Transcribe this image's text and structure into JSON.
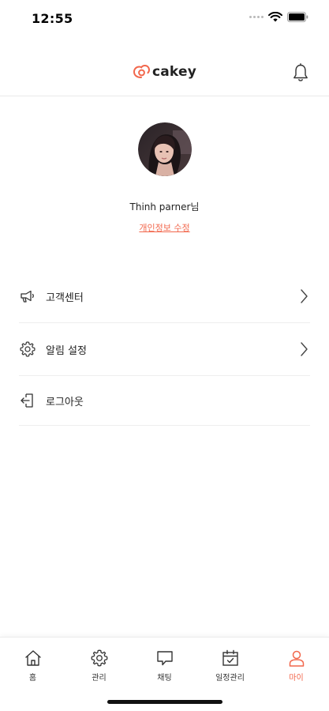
{
  "status_bar": {
    "time": "12:55"
  },
  "header": {
    "logo_text": "cakey",
    "brand_color": "#f2674c"
  },
  "profile": {
    "name": "Thinh parner님",
    "edit_link": "개인정보 수정"
  },
  "menu": {
    "items": [
      {
        "label": "고객센터",
        "icon": "megaphone-icon",
        "has_chevron": true
      },
      {
        "label": "알림 설정",
        "icon": "gear-icon",
        "has_chevron": true
      },
      {
        "label": "로그아웃",
        "icon": "logout-icon",
        "has_chevron": false
      }
    ]
  },
  "tabbar": {
    "active_color": "#f2674c",
    "tabs": [
      {
        "label": "홈",
        "icon": "home-icon",
        "active": false
      },
      {
        "label": "관리",
        "icon": "gear-icon",
        "active": false
      },
      {
        "label": "채팅",
        "icon": "chat-icon",
        "active": false
      },
      {
        "label": "일정관리",
        "icon": "calendar-icon",
        "active": false
      },
      {
        "label": "마이",
        "icon": "user-icon",
        "active": true
      }
    ]
  }
}
